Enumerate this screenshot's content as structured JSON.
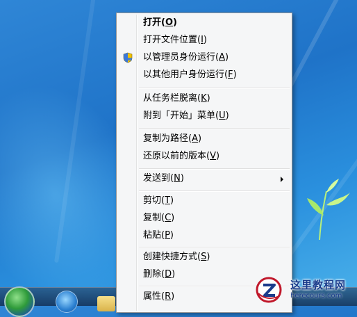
{
  "context_menu": {
    "items": [
      {
        "pre": "打开(",
        "key": "O",
        "post": ")",
        "bold": true
      },
      {
        "pre": "打开文件位置(",
        "key": "I",
        "post": ")"
      },
      {
        "pre": "以管理员身份运行(",
        "key": "A",
        "post": ")",
        "icon": "uac-shield-icon"
      },
      {
        "pre": "以其他用户身份运行(",
        "key": "F",
        "post": ")"
      },
      {
        "pre": "从任务栏脱离(",
        "key": "K",
        "post": ")"
      },
      {
        "pre": "附到「开始」菜单(",
        "key": "U",
        "post": ")"
      },
      {
        "pre": "复制为路径(",
        "key": "A",
        "post": ")"
      },
      {
        "pre": "还原以前的版本(",
        "key": "V",
        "post": ")"
      },
      {
        "pre": "发送到(",
        "key": "N",
        "post": ")",
        "submenu": true
      },
      {
        "pre": "剪切(",
        "key": "T",
        "post": ")"
      },
      {
        "pre": "复制(",
        "key": "C",
        "post": ")"
      },
      {
        "pre": "粘贴(",
        "key": "P",
        "post": ")"
      },
      {
        "pre": "创建快捷方式(",
        "key": "S",
        "post": ")"
      },
      {
        "pre": "删除(",
        "key": "D",
        "post": ")"
      },
      {
        "pre": "属性(",
        "key": "R",
        "post": ")"
      }
    ]
  },
  "watermark": {
    "title": "这里教程网",
    "url": "herecours.com"
  },
  "colors": {
    "menu_bg": "#f5f6f7",
    "menu_border": "#979797",
    "desktop_blue": "#1f73c8",
    "watermark_text": "#1a3c8c"
  }
}
